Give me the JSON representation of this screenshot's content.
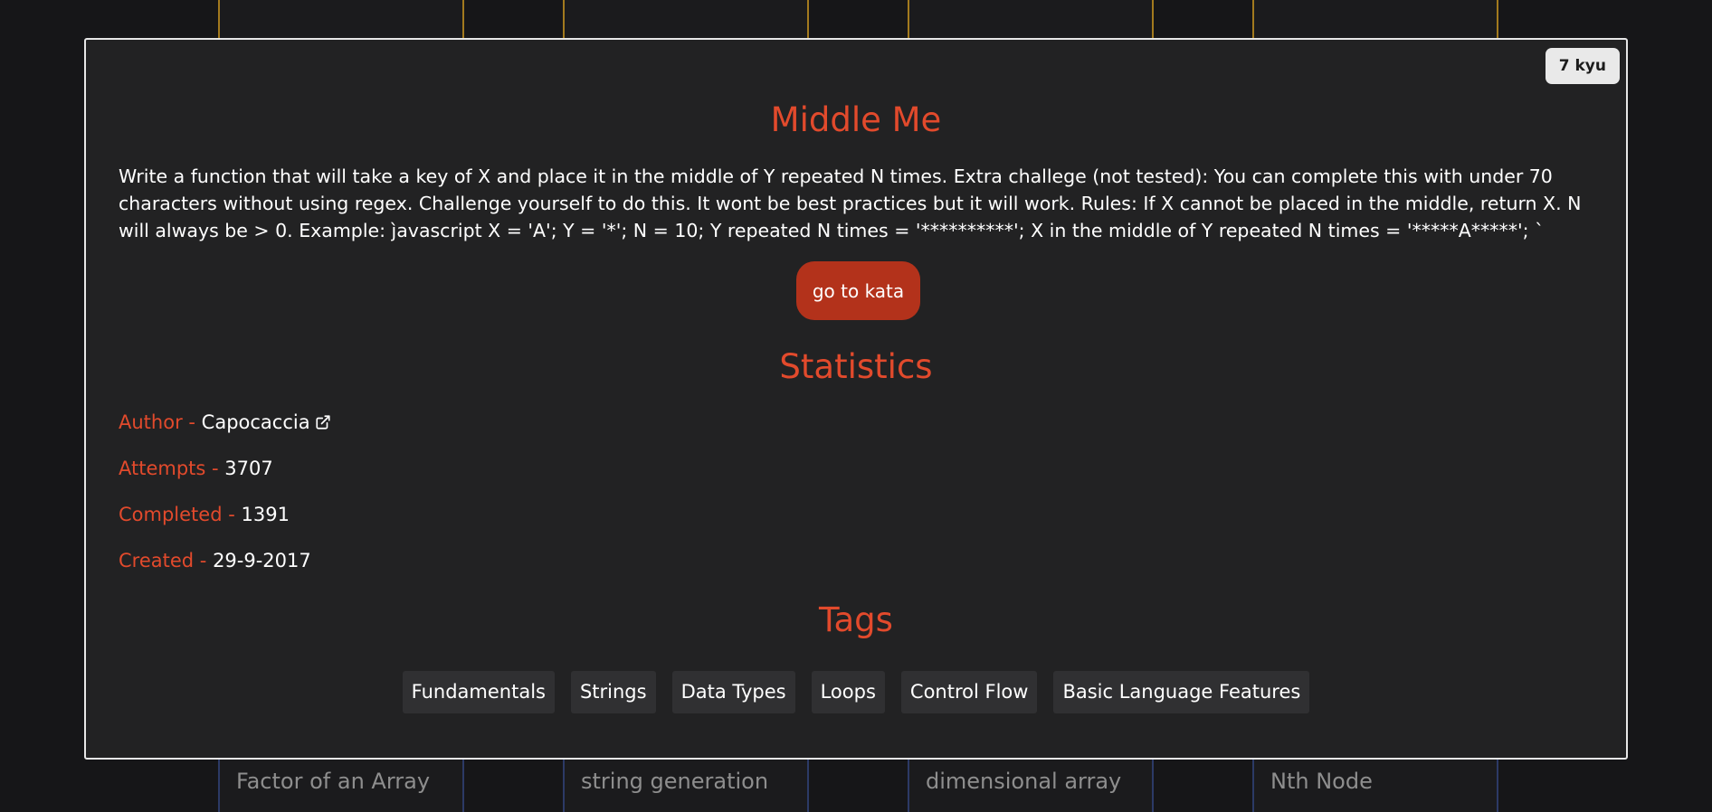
{
  "background_cards": {
    "top": [
      {},
      {},
      {},
      {},
      {}
    ],
    "bottom": [
      {
        "text": "Factor of an Array"
      },
      {
        "text": "string generation"
      },
      {
        "text": "dimensional array"
      },
      {
        "text": "Nth Node"
      }
    ]
  },
  "modal": {
    "rank": "7 kyu",
    "title": "Middle Me",
    "description": "Write a function that will take a key of X and place it in the middle of Y repeated N times. Extra challege (not tested): You can complete this with under 70 characters without using regex. Challenge yourself to do this. It wont be best practices but it will work. Rules: If X cannot be placed in the middle, return X. N will always be > 0. Example: ȷ̀avascript X = 'A'; Y = '*'; N = 10; Y repeated N times = '**********'; X in the middle of Y repeated N times = '*****A*****'; `",
    "go_button": "go to kata",
    "statistics_title": "Statistics",
    "stats": {
      "author_label": "Author -",
      "author": "Capocaccia",
      "attempts_label": "Attempts -",
      "attempts": "3707",
      "completed_label": "Completed -",
      "completed": "1391",
      "created_label": "Created -",
      "created": "29-9-2017"
    },
    "tags_title": "Tags",
    "tags": [
      "Fundamentals",
      "Strings",
      "Data Types",
      "Loops",
      "Control Flow",
      "Basic Language Features"
    ]
  },
  "colors": {
    "accent": "#e24a2c",
    "button": "#b3321b",
    "modal_bg": "#222223",
    "page_bg": "#161618",
    "top_card_border": "#a37a1e",
    "bottom_card_border": "#2c3a66"
  },
  "icons": {
    "author_link": "external-link-icon"
  }
}
